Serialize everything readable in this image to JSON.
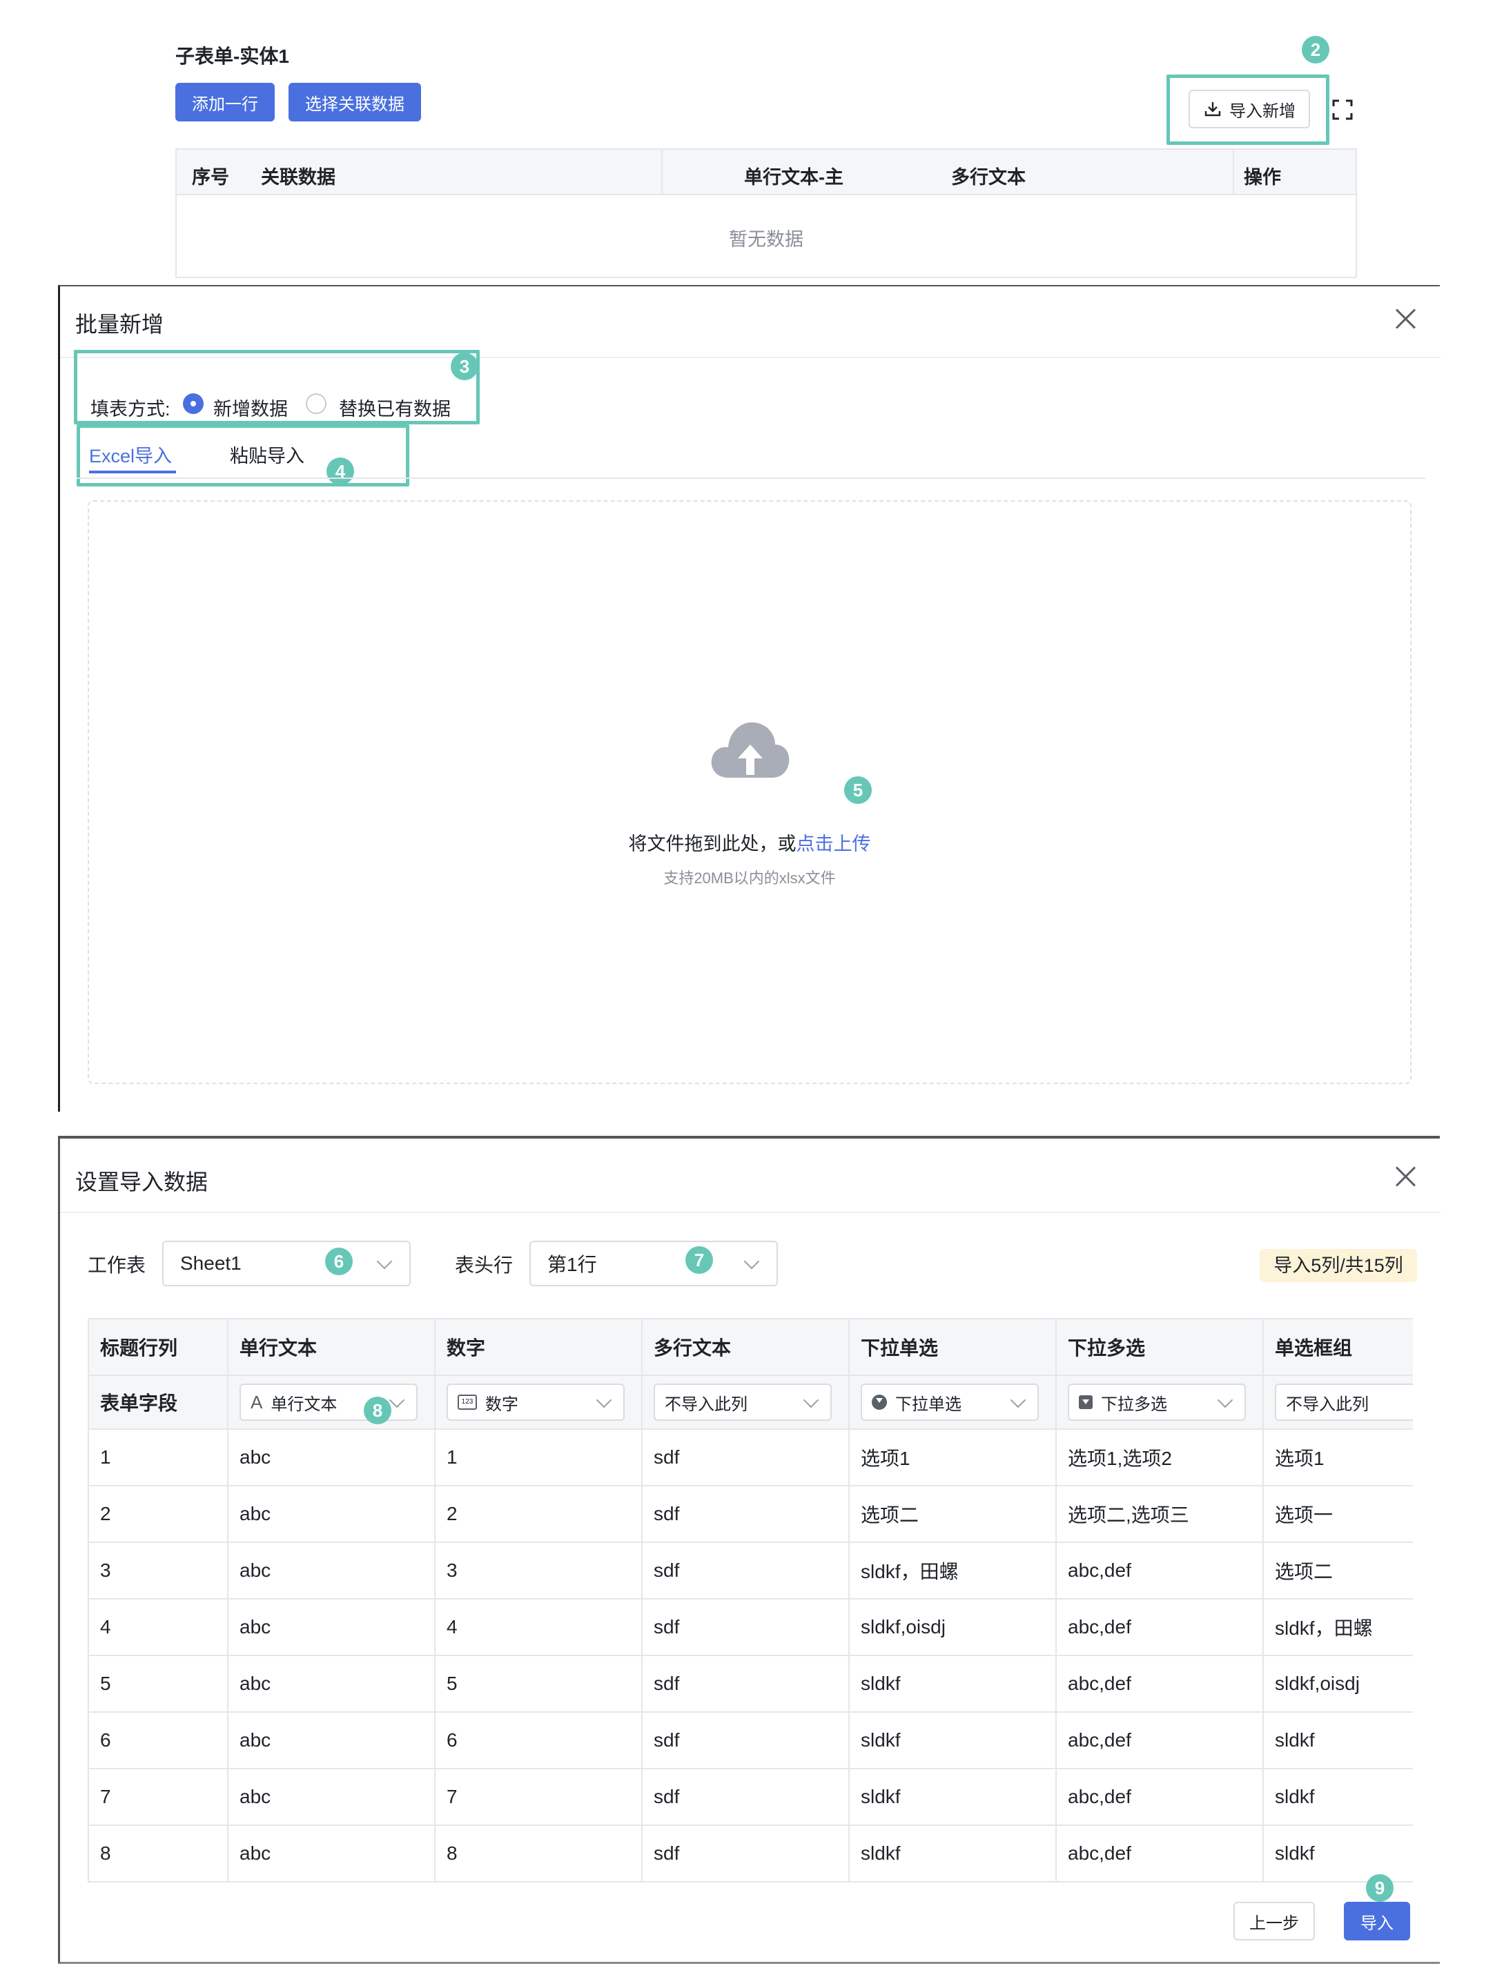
{
  "subform": {
    "title": "子表单-实体1",
    "add_row_label": "添加一行",
    "select_related_label": "选择关联数据",
    "import_new_label": "导入新增",
    "columns": [
      "序号",
      "关联数据",
      "单行文本-主",
      "多行文本",
      "操作"
    ],
    "empty_text": "暂无数据"
  },
  "steps": [
    "2",
    "3",
    "4",
    "5",
    "6",
    "7",
    "8",
    "9"
  ],
  "batch_dialog": {
    "title": "批量新增",
    "fill_mode_label": "填表方式:",
    "options": [
      "新增数据",
      "替换已有数据"
    ],
    "selected_option": "新增数据",
    "tabs": [
      "Excel导入",
      "粘贴导入"
    ],
    "active_tab": "Excel导入",
    "upload_text": "将文件拖到此处，或",
    "upload_link": "点击上传",
    "upload_hint": "支持20MB以内的xlsx文件"
  },
  "import_dialog": {
    "title": "设置导入数据",
    "sheet_label": "工作表",
    "sheet_value": "Sheet1",
    "header_row_label": "表头行",
    "header_row_value": "第1行",
    "summary": "导入5列/共15列",
    "row_labels": [
      "标题行列",
      "表单字段"
    ],
    "columns": [
      {
        "title": "单行文本",
        "field": "单行文本",
        "icon": "text-icon"
      },
      {
        "title": "数字",
        "field": "数字",
        "icon": "number-icon"
      },
      {
        "title": "多行文本",
        "field": "不导入此列",
        "icon": ""
      },
      {
        "title": "下拉单选",
        "field": "下拉单选",
        "icon": "dropdown-single-icon"
      },
      {
        "title": "下拉多选",
        "field": "下拉多选",
        "icon": "dropdown-multi-icon"
      },
      {
        "title": "单选框组",
        "field": "不导入此列",
        "icon": ""
      }
    ],
    "rows": [
      [
        "1",
        "abc",
        "1",
        "sdf",
        "选项1",
        "选项1,选项2",
        "选项1"
      ],
      [
        "2",
        "abc",
        "2",
        "sdf",
        "选项二",
        "选项二,选项三",
        "选项一"
      ],
      [
        "3",
        "abc",
        "3",
        "sdf",
        "sldkf，田螺",
        "abc,def",
        "选项二"
      ],
      [
        "4",
        "abc",
        "4",
        "sdf",
        "sldkf,oisdj",
        "abc,def",
        "sldkf，田螺"
      ],
      [
        "5",
        "abc",
        "5",
        "sdf",
        "sldkf",
        "abc,def",
        "sldkf,oisdj"
      ],
      [
        "6",
        "abc",
        "6",
        "sdf",
        "sldkf",
        "abc,def",
        "sldkf"
      ],
      [
        "7",
        "abc",
        "7",
        "sdf",
        "sldkf",
        "abc,def",
        "sldkf"
      ],
      [
        "8",
        "abc",
        "8",
        "sdf",
        "sldkf",
        "abc,def",
        "sldkf"
      ]
    ],
    "prev_label": "上一步",
    "import_label": "导入"
  },
  "colors": {
    "primary": "#4a70e0",
    "annotation": "#66c7b7",
    "summary_bg": "#fdf3d8"
  }
}
